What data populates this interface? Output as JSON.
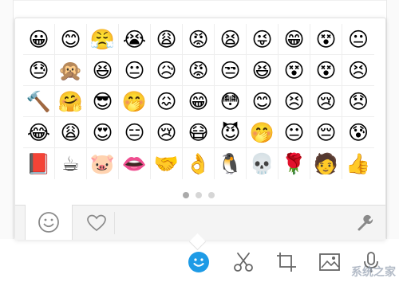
{
  "emoji_panel": {
    "rows": [
      [
        "😀",
        "😊",
        "😤",
        "😭",
        "😩",
        "😡",
        "😫",
        "😜",
        "😁",
        "😵",
        "😐"
      ],
      [
        "😓",
        "🙊",
        "😆",
        "😐",
        "😥",
        "😡",
        "😒",
        "😆",
        "😵",
        "😵",
        "😣"
      ],
      [
        "🔨",
        "🤗",
        "😎",
        "🤭",
        "😖",
        "😁",
        "😳",
        "😊",
        "😣",
        "😢",
        "😞"
      ],
      [
        "😂",
        "😩",
        "😍",
        "😑",
        "😢",
        "😷",
        "😈",
        "🤭",
        "😐",
        "😔",
        "😰"
      ],
      [
        "📕",
        "☕",
        "🐷",
        "👄",
        "🤝",
        "👌",
        "🐧",
        "💀",
        "🌹",
        "🧑",
        "👍"
      ]
    ],
    "page_count": 3,
    "active_page": 1
  },
  "tabs": {
    "emoji_tab_icon": "smiley-outline-icon",
    "favorites_tab_icon": "heart-outline-icon",
    "settings_icon": "wrench-icon"
  },
  "toolbar": {
    "items": [
      "emoji-icon",
      "scissors-icon",
      "screenshot-icon",
      "image-icon",
      "microphone-icon"
    ]
  },
  "colors": {
    "accent_blue": "#1e9be6",
    "icon_gray": "#8a8a8a"
  },
  "watermark_text": "系统之家"
}
